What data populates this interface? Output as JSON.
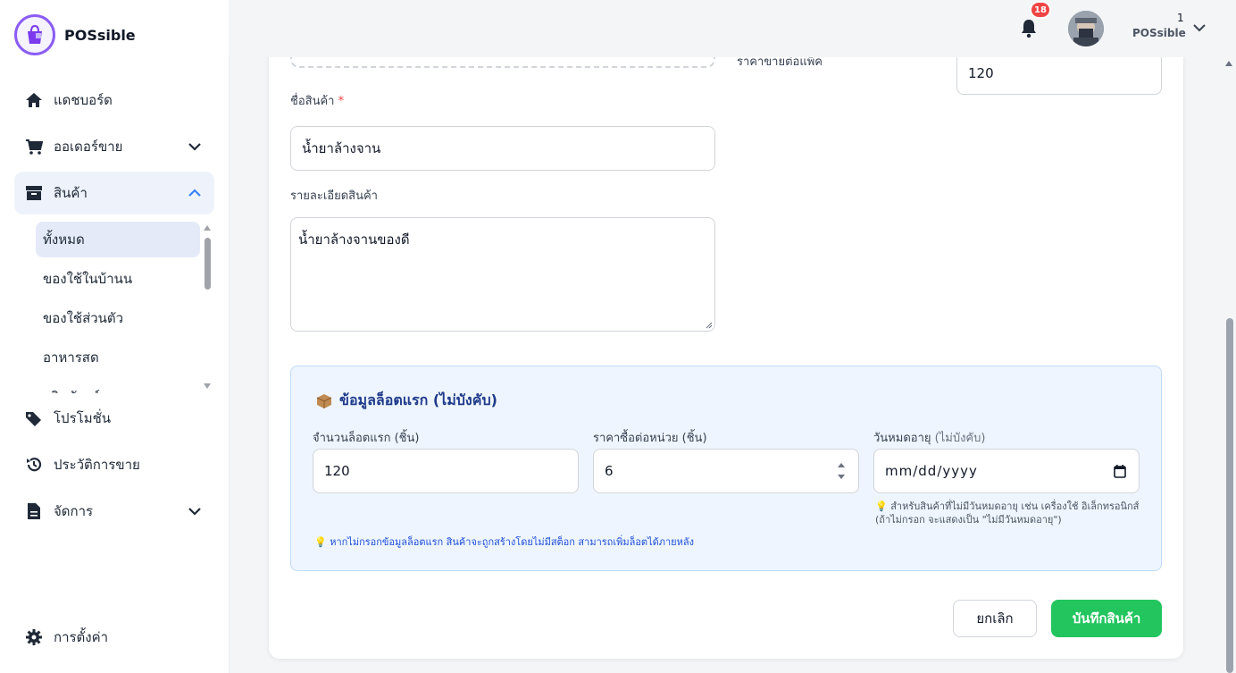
{
  "brand": {
    "name": "POSsible",
    "accent": "#8b5cf6"
  },
  "sidebar": {
    "items": [
      {
        "label": "แดชบอร์ด",
        "icon": "home-icon"
      },
      {
        "label": "ออเดอร์ขาย",
        "icon": "cart-icon"
      },
      {
        "label": "สินค้า",
        "icon": "box-icon"
      },
      {
        "label": "โปรโมชั่น",
        "icon": "tags-icon"
      },
      {
        "label": "ประวัติการขาย",
        "icon": "history-icon"
      },
      {
        "label": "จัดการ",
        "icon": "file-icon"
      },
      {
        "label": "การตั้งค่า",
        "icon": "gear-icon"
      }
    ],
    "subitems": [
      "ทั้งหมด",
      "ของใช้ในบ้านน",
      "ของใช้ส่วนตัว",
      "อาหารสด",
      "ผลิตภัณฑ์"
    ]
  },
  "topbar": {
    "notification_count": "18",
    "user_number": "1",
    "user_name": "POSsible"
  },
  "form": {
    "price_per_pack_label": "ราคาขายต่อแพ็ค",
    "price_per_pack_value": "120",
    "name_label": "ชื่อสินค้า",
    "required_mark": "*",
    "name_value": "น้ำยาล้างจาน",
    "detail_label": "รายละเอียดสินค้า",
    "detail_value": "น้ำยาล้างจานของดี"
  },
  "lot": {
    "title": "ข้อมูลล็อตแรก (ไม่บังคับ)",
    "qty_label": "จำนวนล็อตแรก (ชิ้น)",
    "qty_value": "120",
    "cost_label": "ราคาซื้อต่อหน่วย (ชิ้น)",
    "cost_value": "6",
    "expiry_label": "วันหมดอายุ",
    "expiry_optional": "(ไม่บังคับ)",
    "expiry_placeholder": "mm/dd/yyyy",
    "expiry_hint_line1": "สำหรับสินค้าที่ไม่มีวันหมดอายุ เช่น เครื่องใช้ อิเล็กทรอนิกส์",
    "expiry_hint_line2": "(ถ้าไม่กรอก จะแสดงเป็น \"ไม่มีวันหมดอายุ\")",
    "footer_hint": "หากไม่กรอกข้อมูลล็อตแรก สินค้าจะถูกสร้างโดยไม่มีสต็อก สามารถเพิ่มล็อตได้ภายหลัง"
  },
  "actions": {
    "cancel": "ยกเลิก",
    "save": "บันทึกสินค้า"
  },
  "colors": {
    "save": "#22c55e",
    "lot_bg": "#eef5fe",
    "lot_title": "#1e3a8a",
    "badge": "#ef4444"
  }
}
